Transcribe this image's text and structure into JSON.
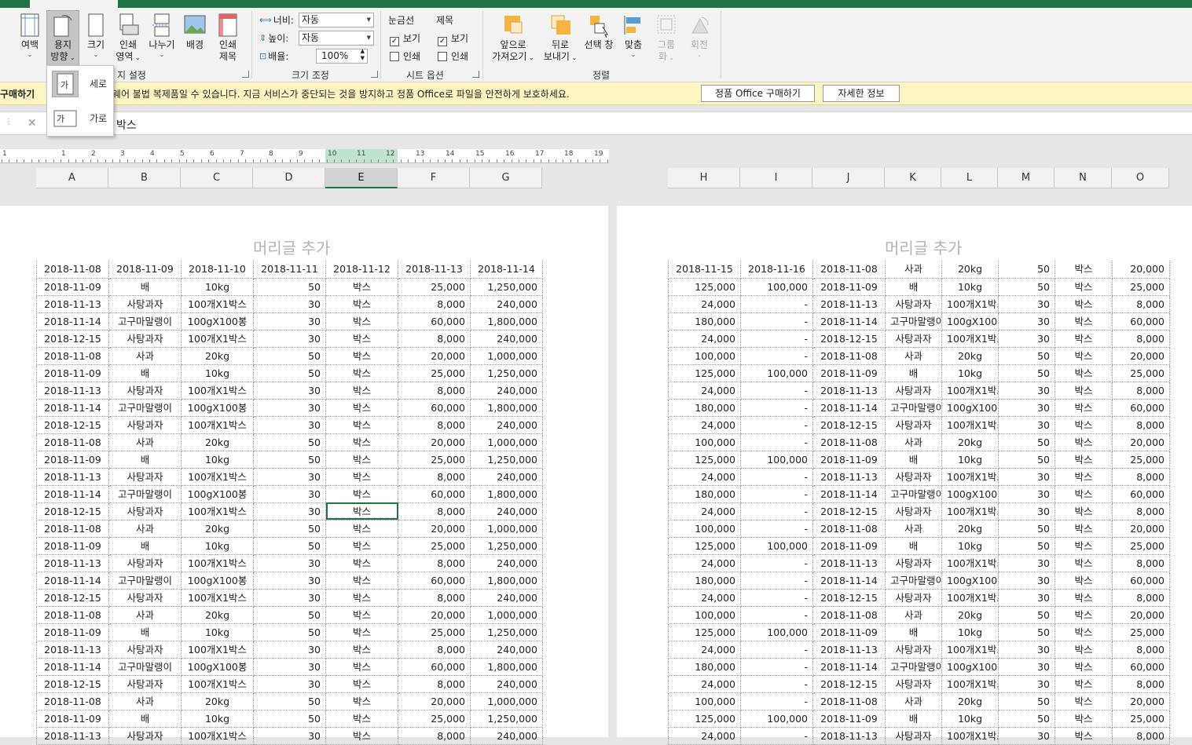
{
  "ribbon": {
    "page_setup": {
      "margins": "여백",
      "orientation_l1": "용지",
      "orientation_l2": "방향",
      "size": "크기",
      "print_area_l1": "인쇄",
      "print_area_l2": "영역",
      "breaks": "나누기",
      "background": "배경",
      "print_titles_l1": "인쇄",
      "print_titles_l2": "제목",
      "group_label": "지 설정"
    },
    "scale": {
      "width_label": "너비:",
      "width_value": "자동",
      "height_label": "높이:",
      "height_value": "자동",
      "scale_label": "배율:",
      "scale_value": "100%",
      "group_label": "크기 조정"
    },
    "sheet_options": {
      "gridlines_header": "눈금선",
      "headings_header": "제목",
      "view": "보기",
      "print": "인쇄",
      "group_label": "시트 옵션"
    },
    "arrange": {
      "bring_forward_l1": "앞으로",
      "bring_forward_l2": "가져오기",
      "send_backward_l1": "뒤로",
      "send_backward_l2": "보내기",
      "selection_pane": "선택 창",
      "align": "맞춤",
      "group_l1": "그룹",
      "group_l2": "화",
      "rotate": "회전",
      "group_label": "정렬"
    }
  },
  "orientation_menu": {
    "portrait": "세로",
    "landscape": "가로",
    "icon_glyph": "가"
  },
  "message_bar": {
    "bold": "구매하기",
    "text": "이 아니고 소프트웨어 불법 복제품일 수 있습니다. 지금 서비스가 중단되는 것을 방지하고 정품 Office로 파일을 안전하게 보호하세요.",
    "buy_button": "정품 Office 구매하기",
    "info_button": "자세한 정보"
  },
  "formula_bar": {
    "cancel": "✕",
    "value": "박스"
  },
  "ruler_numbers": [
    "1",
    "1",
    "2",
    "3",
    "4",
    "5",
    "6",
    "7",
    "8",
    "9",
    "10",
    "11",
    "12",
    "13",
    "14",
    "15",
    "16",
    "17",
    "18",
    "19"
  ],
  "columns_left": [
    "A",
    "B",
    "C",
    "D",
    "E",
    "F",
    "G"
  ],
  "columns_right": [
    "H",
    "I",
    "J",
    "K",
    "L",
    "M",
    "N",
    "O"
  ],
  "page_header": "머리글 추가",
  "left_rows": [
    [
      "2018-11-08",
      "2018-11-09",
      "2018-11-10",
      "2018-11-11",
      "2018-11-12",
      "2018-11-13",
      "2018-11-14"
    ],
    [
      "2018-11-09",
      "배",
      "10kg",
      "50",
      "박스",
      "25,000",
      "1,250,000"
    ],
    [
      "2018-11-13",
      "사탕과자",
      "100개X1박스",
      "30",
      "박스",
      "8,000",
      "240,000"
    ],
    [
      "2018-11-14",
      "고구마말랭이",
      "100gX100봉",
      "30",
      "박스",
      "60,000",
      "1,800,000"
    ],
    [
      "2018-12-15",
      "사탕과자",
      "100개X1박스",
      "30",
      "박스",
      "8,000",
      "240,000"
    ],
    [
      "2018-11-08",
      "사과",
      "20kg",
      "50",
      "박스",
      "20,000",
      "1,000,000"
    ],
    [
      "2018-11-09",
      "배",
      "10kg",
      "50",
      "박스",
      "25,000",
      "1,250,000"
    ],
    [
      "2018-11-13",
      "사탕과자",
      "100개X1박스",
      "30",
      "박스",
      "8,000",
      "240,000"
    ],
    [
      "2018-11-14",
      "고구마말랭이",
      "100gX100봉",
      "30",
      "박스",
      "60,000",
      "1,800,000"
    ],
    [
      "2018-12-15",
      "사탕과자",
      "100개X1박스",
      "30",
      "박스",
      "8,000",
      "240,000"
    ],
    [
      "2018-11-08",
      "사과",
      "20kg",
      "50",
      "박스",
      "20,000",
      "1,000,000"
    ],
    [
      "2018-11-09",
      "배",
      "10kg",
      "50",
      "박스",
      "25,000",
      "1,250,000"
    ],
    [
      "2018-11-13",
      "사탕과자",
      "100개X1박스",
      "30",
      "박스",
      "8,000",
      "240,000"
    ],
    [
      "2018-11-14",
      "고구마말랭이",
      "100gX100봉",
      "30",
      "박스",
      "60,000",
      "1,800,000"
    ],
    [
      "2018-12-15",
      "사탕과자",
      "100개X1박스",
      "30",
      "박스",
      "8,000",
      "240,000"
    ],
    [
      "2018-11-08",
      "사과",
      "20kg",
      "50",
      "박스",
      "20,000",
      "1,000,000"
    ],
    [
      "2018-11-09",
      "배",
      "10kg",
      "50",
      "박스",
      "25,000",
      "1,250,000"
    ],
    [
      "2018-11-13",
      "사탕과자",
      "100개X1박스",
      "30",
      "박스",
      "8,000",
      "240,000"
    ],
    [
      "2018-11-14",
      "고구마말랭이",
      "100gX100봉",
      "30",
      "박스",
      "60,000",
      "1,800,000"
    ],
    [
      "2018-12-15",
      "사탕과자",
      "100개X1박스",
      "30",
      "박스",
      "8,000",
      "240,000"
    ],
    [
      "2018-11-08",
      "사과",
      "20kg",
      "50",
      "박스",
      "20,000",
      "1,000,000"
    ],
    [
      "2018-11-09",
      "배",
      "10kg",
      "50",
      "박스",
      "25,000",
      "1,250,000"
    ],
    [
      "2018-11-13",
      "사탕과자",
      "100개X1박스",
      "30",
      "박스",
      "8,000",
      "240,000"
    ],
    [
      "2018-11-14",
      "고구마말랭이",
      "100gX100봉",
      "30",
      "박스",
      "60,000",
      "1,800,000"
    ],
    [
      "2018-12-15",
      "사탕과자",
      "100개X1박스",
      "30",
      "박스",
      "8,000",
      "240,000"
    ],
    [
      "2018-11-08",
      "사과",
      "20kg",
      "50",
      "박스",
      "20,000",
      "1,000,000"
    ],
    [
      "2018-11-09",
      "배",
      "10kg",
      "50",
      "박스",
      "25,000",
      "1,250,000"
    ],
    [
      "2018-11-13",
      "사탕과자",
      "100개X1박스",
      "30",
      "박스",
      "8,000",
      "240,000"
    ]
  ],
  "right_rows": [
    [
      "2018-11-15",
      "2018-11-16",
      "2018-11-08",
      "사과",
      "20kg",
      "50",
      "박스",
      "20,000"
    ],
    [
      "125,000",
      "100,000",
      "2018-11-09",
      "배",
      "10kg",
      "50",
      "박스",
      "25,000"
    ],
    [
      "24,000",
      "-",
      "2018-11-13",
      "사탕과자",
      "100개X1박스",
      "30",
      "박스",
      "8,000"
    ],
    [
      "180,000",
      "-",
      "2018-11-14",
      "고구마말랭이",
      "100gX100봉",
      "30",
      "박스",
      "60,000"
    ],
    [
      "24,000",
      "-",
      "2018-12-15",
      "사탕과자",
      "100개X1박스",
      "30",
      "박스",
      "8,000"
    ],
    [
      "100,000",
      "-",
      "2018-11-08",
      "사과",
      "20kg",
      "50",
      "박스",
      "20,000"
    ],
    [
      "125,000",
      "100,000",
      "2018-11-09",
      "배",
      "10kg",
      "50",
      "박스",
      "25,000"
    ],
    [
      "24,000",
      "-",
      "2018-11-13",
      "사탕과자",
      "100개X1박스",
      "30",
      "박스",
      "8,000"
    ],
    [
      "180,000",
      "-",
      "2018-11-14",
      "고구마말랭이",
      "100gX100봉",
      "30",
      "박스",
      "60,000"
    ],
    [
      "24,000",
      "-",
      "2018-12-15",
      "사탕과자",
      "100개X1박스",
      "30",
      "박스",
      "8,000"
    ],
    [
      "100,000",
      "-",
      "2018-11-08",
      "사과",
      "20kg",
      "50",
      "박스",
      "20,000"
    ],
    [
      "125,000",
      "100,000",
      "2018-11-09",
      "배",
      "10kg",
      "50",
      "박스",
      "25,000"
    ],
    [
      "24,000",
      "-",
      "2018-11-13",
      "사탕과자",
      "100개X1박스",
      "30",
      "박스",
      "8,000"
    ],
    [
      "180,000",
      "-",
      "2018-11-14",
      "고구마말랭이",
      "100gX100봉",
      "30",
      "박스",
      "60,000"
    ],
    [
      "24,000",
      "-",
      "2018-12-15",
      "사탕과자",
      "100개X1박스",
      "30",
      "박스",
      "8,000"
    ],
    [
      "100,000",
      "-",
      "2018-11-08",
      "사과",
      "20kg",
      "50",
      "박스",
      "20,000"
    ],
    [
      "125,000",
      "100,000",
      "2018-11-09",
      "배",
      "10kg",
      "50",
      "박스",
      "25,000"
    ],
    [
      "24,000",
      "-",
      "2018-11-13",
      "사탕과자",
      "100개X1박스",
      "30",
      "박스",
      "8,000"
    ],
    [
      "180,000",
      "-",
      "2018-11-14",
      "고구마말랭이",
      "100gX100봉",
      "30",
      "박스",
      "60,000"
    ],
    [
      "24,000",
      "-",
      "2018-12-15",
      "사탕과자",
      "100개X1박스",
      "30",
      "박스",
      "8,000"
    ],
    [
      "100,000",
      "-",
      "2018-11-08",
      "사과",
      "20kg",
      "50",
      "박스",
      "20,000"
    ],
    [
      "125,000",
      "100,000",
      "2018-11-09",
      "배",
      "10kg",
      "50",
      "박스",
      "25,000"
    ],
    [
      "24,000",
      "-",
      "2018-11-13",
      "사탕과자",
      "100개X1박스",
      "30",
      "박스",
      "8,000"
    ],
    [
      "180,000",
      "-",
      "2018-11-14",
      "고구마말랭이",
      "100gX100봉",
      "30",
      "박스",
      "60,000"
    ],
    [
      "24,000",
      "-",
      "2018-12-15",
      "사탕과자",
      "100개X1박스",
      "30",
      "박스",
      "8,000"
    ],
    [
      "100,000",
      "-",
      "2018-11-08",
      "사과",
      "20kg",
      "50",
      "박스",
      "20,000"
    ],
    [
      "125,000",
      "100,000",
      "2018-11-09",
      "배",
      "10kg",
      "50",
      "박스",
      "25,000"
    ],
    [
      "24,000",
      "-",
      "2018-11-13",
      "사탕과자",
      "100개X1박스",
      "30",
      "박스",
      "8,000"
    ]
  ],
  "active_cell": {
    "table": "left",
    "row": 14,
    "col": 4
  },
  "colors": {
    "excel_green": "#217346",
    "message_bar": "#fdf6c3",
    "icon_orange": "#f5b342"
  }
}
